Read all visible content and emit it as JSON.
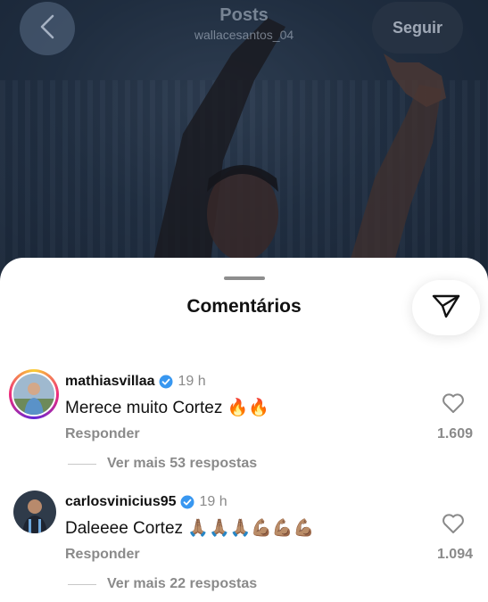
{
  "header": {
    "title": "Posts",
    "username": "wallacesantos_04",
    "follow_label": "Seguir"
  },
  "sheet": {
    "title": "Comentários"
  },
  "comments": [
    {
      "username": "mathiasvillaa",
      "verified": true,
      "time": "19 h",
      "text": "Merece muito Cortez 🔥🔥",
      "reply_label": "Responder",
      "likes": "1.609",
      "more_replies": "Ver mais 53 respostas"
    },
    {
      "username": "carlosvinicius95",
      "verified": true,
      "time": "19 h",
      "text": "Daleeee Cortez 🙏🏽🙏🏽🙏🏽💪🏽💪🏽💪🏽",
      "reply_label": "Responder",
      "likes": "1.094",
      "more_replies": "Ver mais 22 respostas"
    }
  ],
  "colors": {
    "verified": "#3897f0",
    "muted_text": "#8a8a8a"
  }
}
